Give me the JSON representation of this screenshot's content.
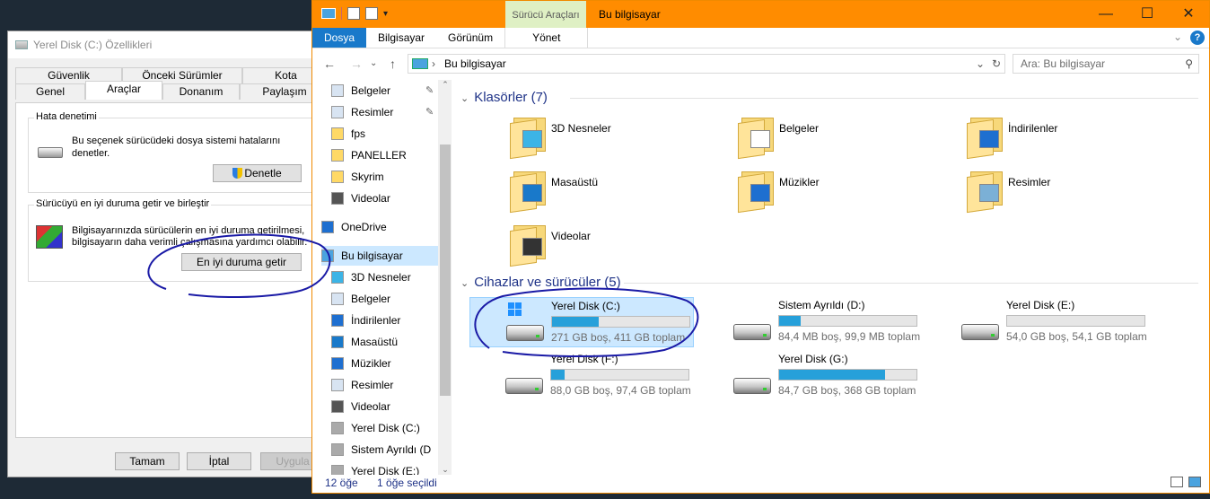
{
  "props_dialog": {
    "title": "Yerel Disk (C:) Özellikleri",
    "tabs_row1": [
      "Güvenlik",
      "Önceki Sürümler",
      "Kota"
    ],
    "tabs_row2": [
      "Genel",
      "Araçlar",
      "Donanım",
      "Paylaşım"
    ],
    "active_tab": "Araçlar",
    "error_check": {
      "title": "Hata denetimi",
      "text1": "Bu seçenek sürücüdeki dosya sistemi hatalarını",
      "text2": "denetler.",
      "button": "Denetle"
    },
    "optimize": {
      "title": "Sürücüyü en iyi duruma getir ve birleştir",
      "text1": "Bilgisayarınızda sürücülerin en iyi duruma getirilmesi,",
      "text2": "bilgisayarın daha verimli çalışmasına yardımcı olabilir.",
      "button": "En iyi duruma getir"
    },
    "footer": {
      "ok": "Tamam",
      "cancel": "İptal",
      "apply": "Uygula"
    }
  },
  "explorer": {
    "context_tab_group": "Sürücü Araçları",
    "window_title": "Bu bilgisayar",
    "ribbon_tabs": {
      "file": "Dosya",
      "computer": "Bilgisayar",
      "view": "Görünüm",
      "manage": "Yönet"
    },
    "address": "Bu bilgisayar",
    "search_placeholder": "Ara: Bu bilgisayar",
    "nav_items": [
      {
        "label": "Belgeler",
        "pinned": true
      },
      {
        "label": "Resimler",
        "pinned": true
      },
      {
        "label": "fps"
      },
      {
        "label": "PANELLER"
      },
      {
        "label": "Skyrim"
      },
      {
        "label": "Videolar"
      },
      {
        "label": "OneDrive"
      },
      {
        "label": "Bu bilgisayar",
        "selected": true
      },
      {
        "label": "3D Nesneler"
      },
      {
        "label": "Belgeler"
      },
      {
        "label": "İndirilenler"
      },
      {
        "label": "Masaüstü"
      },
      {
        "label": "Müzikler"
      },
      {
        "label": "Resimler"
      },
      {
        "label": "Videolar"
      },
      {
        "label": "Yerel Disk (C:)"
      },
      {
        "label": "Sistem Ayrıldı (D"
      },
      {
        "label": "Yerel Disk (E:)"
      }
    ],
    "folders_header": "Klasörler (7)",
    "folders": [
      "3D Nesneler",
      "Belgeler",
      "İndirilenler",
      "Masaüstü",
      "Müzikler",
      "Resimler",
      "Videolar"
    ],
    "drives_header": "Cihazlar ve sürücüler (5)",
    "drives": [
      {
        "name": "Yerel Disk (C:)",
        "free": "271 GB boş, 411 GB toplam",
        "used_fraction": 0.34,
        "selected": true,
        "system": true
      },
      {
        "name": "Sistem Ayrıldı (D:)",
        "free": "84,4 MB boş, 99,9 MB toplam",
        "used_fraction": 0.16
      },
      {
        "name": "Yerel Disk (E:)",
        "free": "54,0 GB boş, 54,1 GB toplam",
        "used_fraction": 0.0
      },
      {
        "name": "Yerel Disk (F:)",
        "free": "88,0 GB boş, 97,4 GB toplam",
        "used_fraction": 0.1
      },
      {
        "name": "Yerel Disk (G:)",
        "free": "84,7 GB boş, 368 GB toplam",
        "used_fraction": 0.77
      }
    ],
    "status": {
      "count": "12 öğe",
      "selected": "1 öğe seçildi"
    }
  },
  "colors": {
    "accent": "#ff8c00",
    "selection": "#cce8ff",
    "bar_fill": "#26a0da",
    "annotation": "#1a1aa6"
  }
}
